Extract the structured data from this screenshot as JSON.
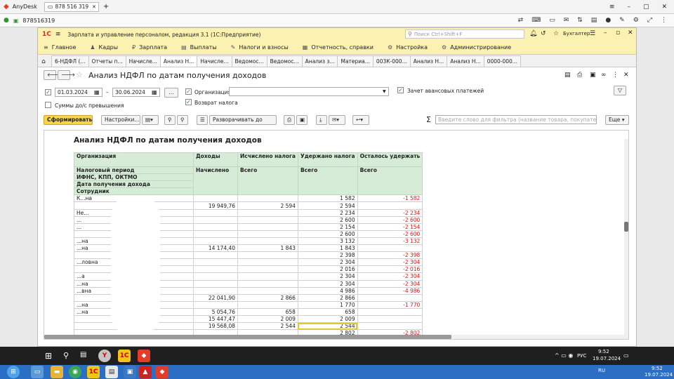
{
  "anydesk": {
    "title": "AnyDesk",
    "session_tab": "878 516 319",
    "active_session": "878516319"
  },
  "app": {
    "window_title": "Зарплата и управление персоналом, редакция 3.1  (1С:Предприятие)",
    "search_placeholder": "Поиск Ctrl+Shift+F",
    "user": "Бухгалтер"
  },
  "sections": [
    {
      "icon": "≡",
      "label": "Главное"
    },
    {
      "icon": "♟",
      "label": "Кадры"
    },
    {
      "icon": "₽",
      "label": "Зарплата"
    },
    {
      "icon": "▤",
      "label": "Выплаты"
    },
    {
      "icon": "✎",
      "label": "Налоги и взносы"
    },
    {
      "icon": "▦",
      "label": "Отчетность, справки"
    },
    {
      "icon": "⚙",
      "label": "Настройка"
    },
    {
      "icon": "⚙",
      "label": "Администрирование"
    }
  ],
  "open_tabs": [
    "6-НДФЛ (...",
    "Отчеты п...",
    "Начисле...",
    "Анализ Н...",
    "Начисле...",
    "Ведомос...",
    "Ведомос...",
    "Анализ з...",
    "Материа...",
    "003К-000...",
    "Анализ Н...",
    "Анализ Н...",
    "0000-000..."
  ],
  "form": {
    "title": "Анализ НДФЛ по датам получения доходов",
    "date_from": "01.03.2024",
    "date_to": "30.06.2024",
    "dash": "–",
    "select_btn": "...",
    "org_label": "Организация:",
    "org_value": "",
    "advance_label": "Зачет авансовых платежей",
    "return_label": "Возврат налога",
    "sums_label": "Суммы до/с превышения",
    "generate_btn": "Сформировать",
    "settings_btn": "Настройки...",
    "expand_btn": "Разворачивать до",
    "filter_placeholder": "Введите слово для фильтра (название товара, покупателя и пр.)",
    "more_btn": "Еще"
  },
  "report": {
    "title": "Анализ НДФЛ по датам получения доходов",
    "headers": {
      "org": "Организация",
      "period": "Налоговый период",
      "ifns": "ИФНС, КПП, ОКТМО",
      "date": "Дата получения дохода",
      "employee": "Сотрудник",
      "income": "Доходы",
      "calc": "Исчислено налога",
      "withheld": "Удержано налога",
      "left": "Осталось удержать",
      "income_sub": "Начислено",
      "calc_sub": "Всего",
      "withheld_sub": "Всего",
      "left_sub": "Всего"
    },
    "rows": [
      {
        "name": "К...на",
        "income": "",
        "calc": "",
        "withheld": "1 582",
        "left": "-1 582"
      },
      {
        "name": "",
        "income": "19 949,76",
        "calc": "2 594",
        "withheld": "2 594",
        "left": ""
      },
      {
        "name": "Не...",
        "income": "",
        "calc": "",
        "withheld": "2 234",
        "left": "-2 234"
      },
      {
        "name": "...",
        "income": "",
        "calc": "",
        "withheld": "2 600",
        "left": "-2 600"
      },
      {
        "name": "...",
        "income": "",
        "calc": "",
        "withheld": "2 154",
        "left": "-2 154"
      },
      {
        "name": "",
        "income": "",
        "calc": "",
        "withheld": "2 600",
        "left": "-2 600"
      },
      {
        "name": "...на",
        "income": "",
        "calc": "",
        "withheld": "3 132",
        "left": "-3 132"
      },
      {
        "name": "...на",
        "income": "14 174,40",
        "calc": "1 843",
        "withheld": "1 843",
        "left": ""
      },
      {
        "name": "",
        "income": "",
        "calc": "",
        "withheld": "2 398",
        "left": "-2 398"
      },
      {
        "name": "...ловна",
        "income": "",
        "calc": "",
        "withheld": "2 304",
        "left": "-2 304"
      },
      {
        "name": "",
        "income": "",
        "calc": "",
        "withheld": "2 016",
        "left": "-2 016"
      },
      {
        "name": "...а",
        "income": "",
        "calc": "",
        "withheld": "2 304",
        "left": "-2 304"
      },
      {
        "name": "...на",
        "income": "",
        "calc": "",
        "withheld": "2 304",
        "left": "-2 304"
      },
      {
        "name": "...вна",
        "income": "",
        "calc": "",
        "withheld": "4 986",
        "left": "-4 986"
      },
      {
        "name": "",
        "income": "22 041,90",
        "calc": "2 866",
        "withheld": "2 866",
        "left": ""
      },
      {
        "name": "...на",
        "income": "",
        "calc": "",
        "withheld": "1 770",
        "left": "-1 770"
      },
      {
        "name": "...на",
        "income": "5 054,76",
        "calc": "658",
        "withheld": "658",
        "left": ""
      },
      {
        "name": "",
        "income": "15 447,47",
        "calc": "2 009",
        "withheld": "2 009",
        "left": ""
      },
      {
        "name": "",
        "income": "19 568,08",
        "calc": "2 544",
        "withheld": "2 544",
        "left": ""
      },
      {
        "name": "",
        "income": "",
        "calc": "",
        "withheld": "2 802",
        "left": "-2 802"
      }
    ]
  },
  "taskbar": {
    "time": "9:52",
    "date": "19.07.2024",
    "lang": "РУС"
  },
  "hostbar": {
    "time": "9:52",
    "date": "19.07.2024",
    "lang": "RU"
  }
}
